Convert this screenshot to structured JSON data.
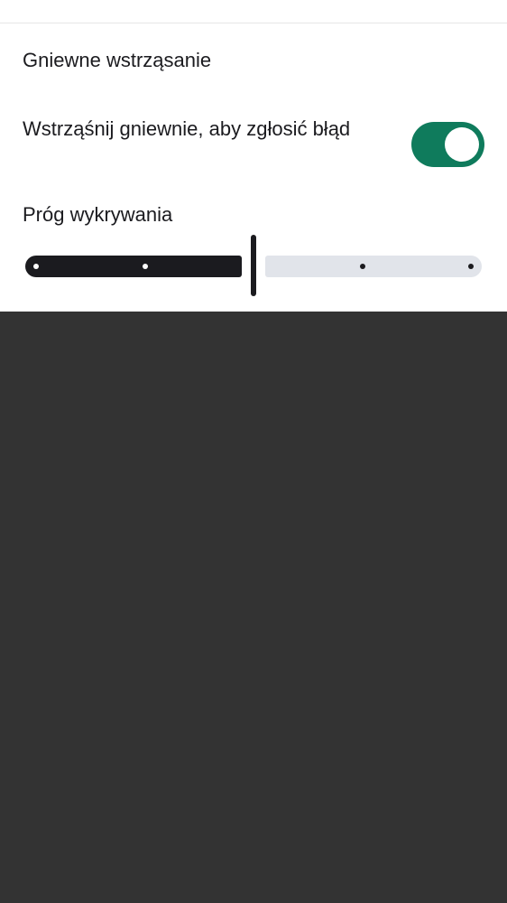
{
  "dialog": {
    "title": "Gniewne wstrząsanie"
  },
  "shake_setting": {
    "label": "Wstrząśnij gniewnie, aby zgłosić błąd",
    "enabled": true,
    "accent_color": "#0f7b5c"
  },
  "threshold": {
    "label": "Próg wykrywania",
    "steps": 5,
    "value_index": 2
  }
}
